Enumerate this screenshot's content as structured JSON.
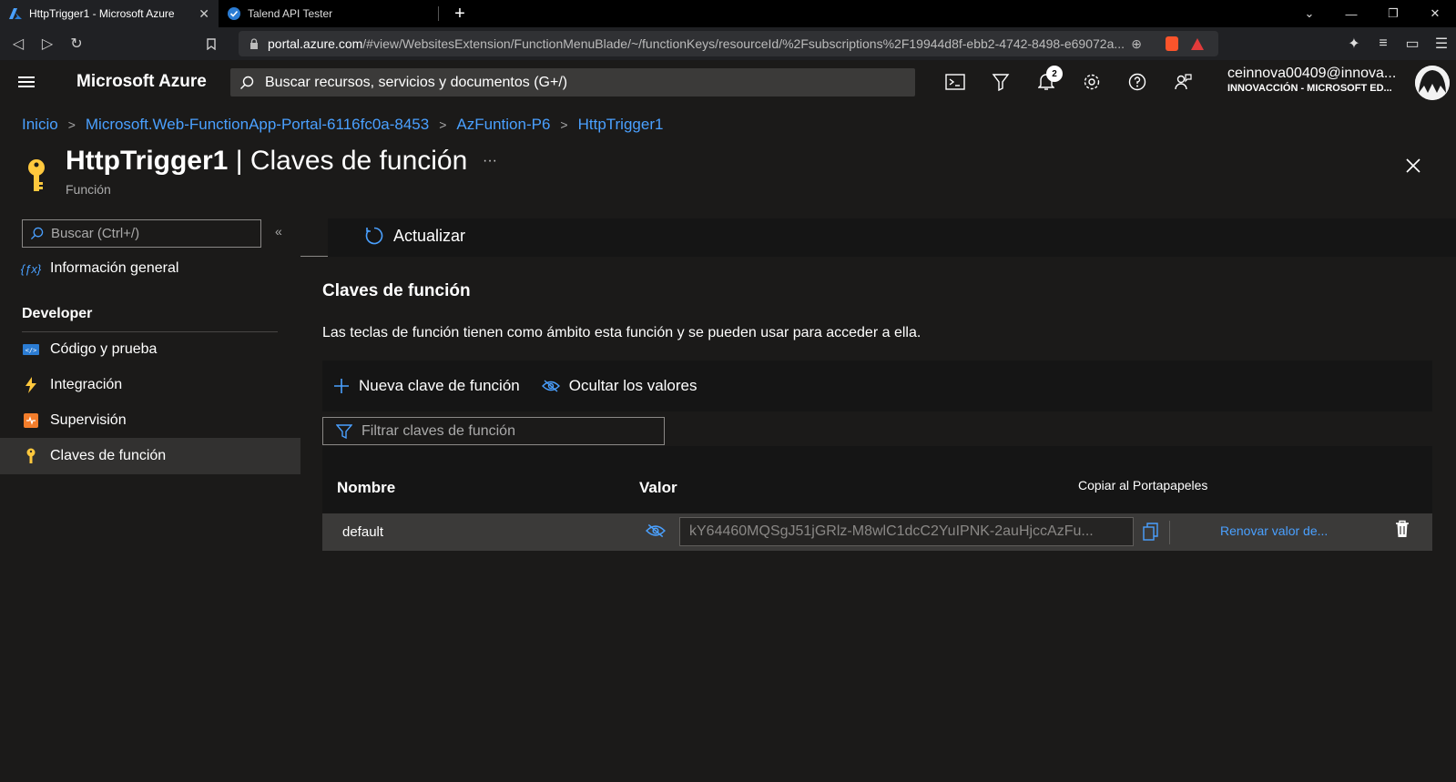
{
  "browser": {
    "tabs": [
      {
        "title": "HttpTrigger1 - Microsoft Azure",
        "active": true
      },
      {
        "title": "Talend API Tester",
        "active": false
      }
    ],
    "url_host": "portal.azure.com",
    "url_path": "/#view/WebsitesExtension/FunctionMenuBlade/~/functionKeys/resourceId/%2Fsubscriptions%2F19944d8f-ebb2-4742-8498-e69072a..."
  },
  "header": {
    "brand": "Microsoft Azure",
    "search_placeholder": "Buscar recursos, servicios y documentos (G+/)",
    "notification_count": "2",
    "account_user": "ceinnova00409@innova...",
    "account_org": "INNOVACCIÓN - MICROSOFT ED..."
  },
  "breadcrumb": [
    "Inicio",
    "Microsoft.Web-FunctionApp-Portal-6116fc0a-8453",
    "AzFuntion-P6",
    "HttpTrigger1"
  ],
  "page": {
    "title_bold": "HttpTrigger1",
    "title_rest": " | Claves de función",
    "subtitle": "Función",
    "more": "···"
  },
  "sidebar": {
    "search_placeholder": "Buscar (Ctrl+/)",
    "overview": "Información general",
    "group": "Developer",
    "items": [
      {
        "label": "Código y prueba"
      },
      {
        "label": "Integración"
      },
      {
        "label": "Supervisión"
      },
      {
        "label": "Claves de función"
      }
    ]
  },
  "toolbar": {
    "refresh_label": "Actualizar"
  },
  "section": {
    "title": "Claves de función",
    "description": "Las teclas de función tienen como ámbito esta función y se pueden usar para acceder a ella.",
    "new_key_label": "Nueva clave de función",
    "hide_values_label": "Ocultar los valores",
    "filter_placeholder": "Filtrar claves de función"
  },
  "table": {
    "columns": [
      "Nombre",
      "Valor"
    ],
    "tooltip": "Copiar al Portapapeles",
    "rows": [
      {
        "name": "default",
        "value": "kY64460MQSgJ51jGRlz-M8wlC1dcC2YuIPNK-2auHjccAzFu...",
        "renew": "Renovar valor de..."
      }
    ]
  },
  "colors": {
    "accent": "#4aa0ff",
    "key_icon": "#ffc83d",
    "background": "#1b1a19"
  }
}
